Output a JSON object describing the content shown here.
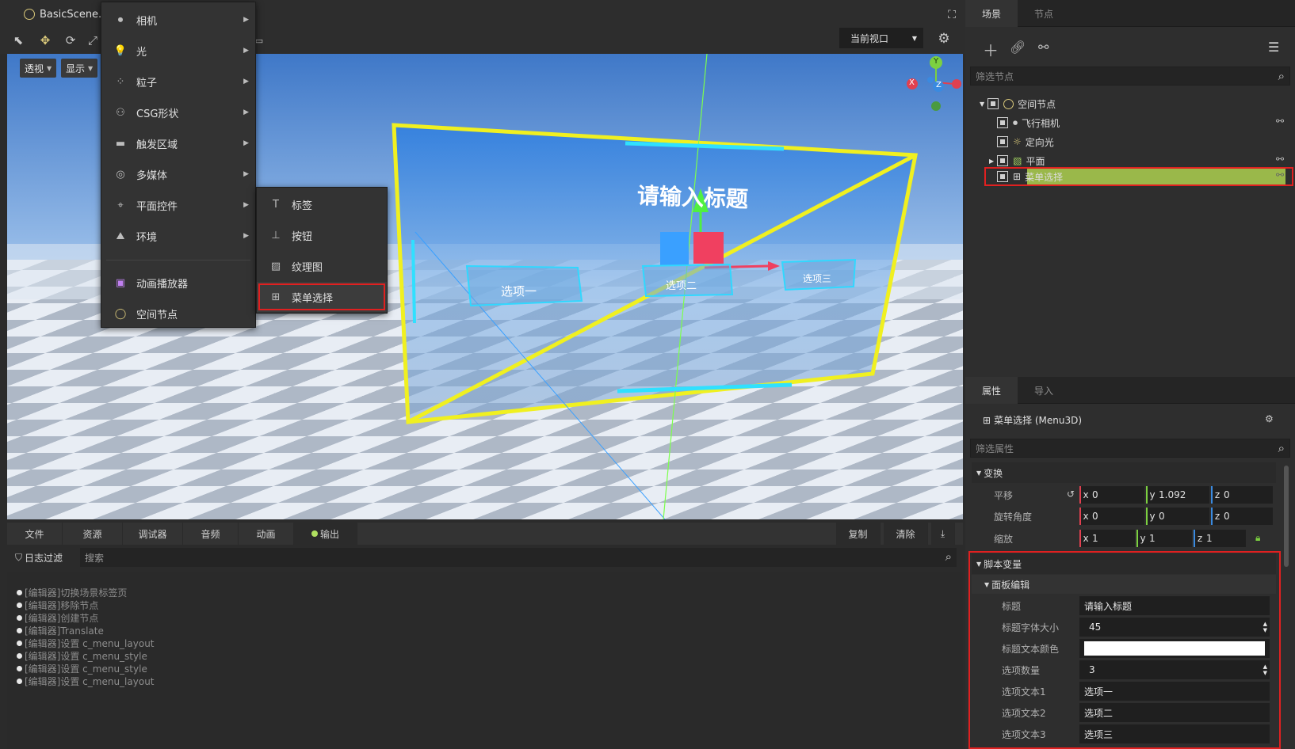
{
  "scene_tab": {
    "label": "BasicScene.s"
  },
  "viewport": {
    "perspective_label": "透视",
    "display_label": "显示",
    "current_view_label": "当前视口",
    "panel_title": "请输入标题",
    "options": [
      "选项一",
      "选项二",
      "选项三"
    ],
    "gizmo": {
      "x": "X",
      "y": "Y",
      "z": "Z"
    }
  },
  "add_menu": {
    "items": [
      {
        "label": "相机",
        "icon": "camera-icon",
        "submenu": true
      },
      {
        "label": "光",
        "icon": "light-icon",
        "submenu": true
      },
      {
        "label": "粒子",
        "icon": "particle-icon",
        "submenu": true
      },
      {
        "label": "CSG形状",
        "icon": "csg-icon",
        "submenu": true
      },
      {
        "label": "触发区域",
        "icon": "trigger-icon",
        "submenu": true
      },
      {
        "label": "多媒体",
        "icon": "media-icon",
        "submenu": true
      },
      {
        "label": "平面控件",
        "icon": "plane-control-icon",
        "submenu": true
      },
      {
        "label": "环境",
        "icon": "environment-icon",
        "submenu": true
      },
      {
        "label": "动画播放器",
        "icon": "animation-player-icon",
        "submenu": false
      },
      {
        "label": "空间节点",
        "icon": "spatial-node-icon",
        "submenu": false
      }
    ]
  },
  "plane_submenu": {
    "items": [
      {
        "label": "标签",
        "icon": "label-icon"
      },
      {
        "label": "按钮",
        "icon": "button-icon"
      },
      {
        "label": "纹理图",
        "icon": "texture-icon"
      },
      {
        "label": "菜单选择",
        "icon": "menu-select-icon"
      }
    ],
    "highlight_color": "#e02020"
  },
  "scene_panel": {
    "tabs": [
      "场景",
      "节点"
    ],
    "filter_placeholder": "筛选节点",
    "tree": [
      {
        "label": "空间节点"
      },
      {
        "label": "飞行相机"
      },
      {
        "label": "定向光"
      },
      {
        "label": "平面"
      },
      {
        "label": "菜单选择"
      }
    ],
    "selected_color": "#9ab84a"
  },
  "inspector": {
    "tabs": [
      "属性",
      "导入"
    ],
    "node_title": "菜单选择 (Menu3D)",
    "filter_placeholder": "筛选属性",
    "transform_section": "变换",
    "translation": {
      "label": "平移",
      "x": "0",
      "y": "1.092",
      "z": "0"
    },
    "rotation": {
      "label": "旋转角度",
      "x": "0",
      "y": "0",
      "z": "0"
    },
    "scale": {
      "label": "缩放",
      "x": "1",
      "y": "1",
      "z": "1"
    },
    "axis_labels": {
      "x": "x",
      "y": "y",
      "z": "z"
    },
    "script_section": "脚本变量",
    "panel_section": "面板编辑",
    "fields": [
      {
        "label": "标题",
        "value": "请输入标题"
      },
      {
        "label": "标题字体大小",
        "value": "45"
      },
      {
        "label": "标题文本颜色",
        "value": ""
      },
      {
        "label": "选项数量",
        "value": "3"
      },
      {
        "label": "选项文本1",
        "value": "选项一"
      },
      {
        "label": "选项文本2",
        "value": "选项二"
      },
      {
        "label": "选项文本3",
        "value": "选项三"
      }
    ]
  },
  "bottom_panel": {
    "tabs": [
      "文件",
      "资源",
      "调试器",
      "音频",
      "动画",
      "输出"
    ],
    "copy_label": "复制",
    "clear_label": "清除",
    "log_filter_label": "日志过滤",
    "search_placeholder": "搜索",
    "logs": [
      "[编辑器]切换场景标签页",
      "[编辑器]移除节点",
      "[编辑器]创建节点",
      "[编辑器]Translate",
      "[编辑器]设置 c_menu_layout",
      "[编辑器]设置 c_menu_style",
      "[编辑器]设置 c_menu_style",
      "[编辑器]设置 c_menu_layout"
    ]
  }
}
